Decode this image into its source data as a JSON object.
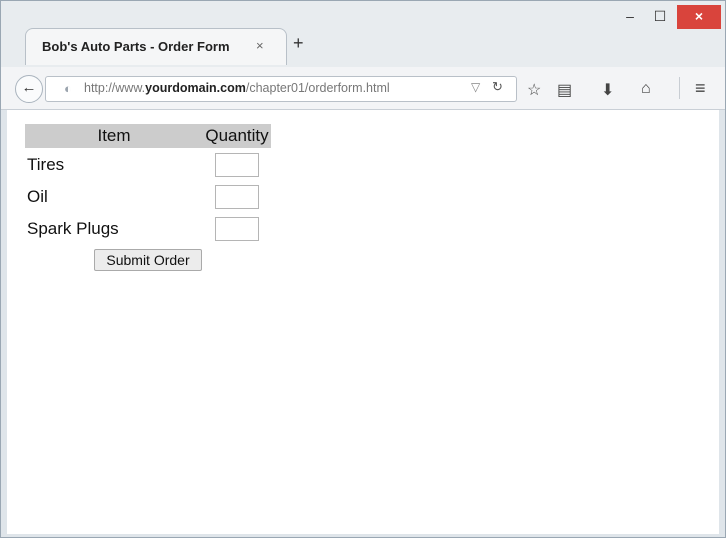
{
  "browser": {
    "tab_title": "Bob's Auto Parts - Order Form",
    "tab_close": "×",
    "new_tab": "+",
    "window_controls": {
      "minimize": "‒",
      "maximize": "☐",
      "close": "×"
    },
    "url": {
      "prefix": "http://www.",
      "domain": "yourdomain.com",
      "path": "/chapter01/orderform.html"
    },
    "icons": [
      "back-arrow-icon",
      "site-identity-icon",
      "url-dropdown-icon",
      "reload-icon",
      "bookmark-star-icon",
      "reader-view-icon",
      "download-icon",
      "home-icon",
      "menu-icon"
    ]
  },
  "form": {
    "headers": {
      "item": "Item",
      "quantity": "Quantity"
    },
    "rows": [
      {
        "item": "Tires",
        "quantity": ""
      },
      {
        "item": "Oil",
        "quantity": ""
      },
      {
        "item": "Spark Plugs",
        "quantity": ""
      }
    ],
    "submit_label": "Submit Order"
  }
}
